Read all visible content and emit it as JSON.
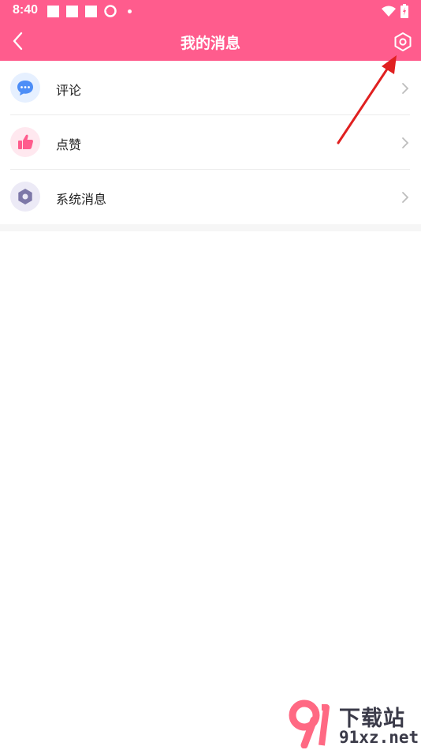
{
  "colors": {
    "accent": "#ff5c8d",
    "comment_icon_bg": "#e6f0ff",
    "comment_icon": "#4d8ef7",
    "like_icon_bg": "#ffe8ef",
    "like_icon": "#ff5c8d",
    "system_icon_bg": "#eceaf6",
    "system_icon": "#7d78a8"
  },
  "status_bar": {
    "time": "8:40"
  },
  "header": {
    "title": "我的消息"
  },
  "items": [
    {
      "label": "评论",
      "icon": "chat-bubble-icon"
    },
    {
      "label": "点赞",
      "icon": "thumbs-up-icon"
    },
    {
      "label": "系统消息",
      "icon": "gear-icon"
    }
  ],
  "watermark": {
    "line1": "下载站",
    "line2": "91xz.net"
  }
}
